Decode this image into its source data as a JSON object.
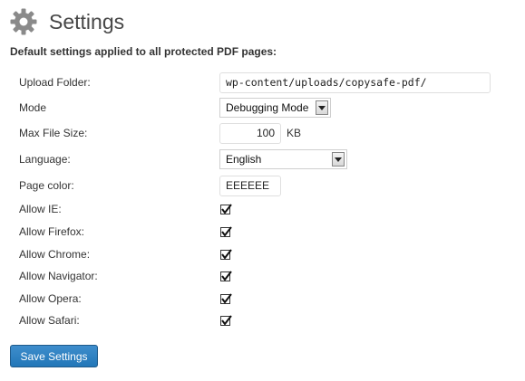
{
  "header": {
    "title": "Settings",
    "icon": "gear-icon"
  },
  "subtitle": "Default settings applied to all protected PDF pages:",
  "fields": {
    "upload_folder": {
      "label": "Upload Folder:",
      "value": "wp-content/uploads/copysafe-pdf/"
    },
    "mode": {
      "label": "Mode",
      "value": "Debugging Mode"
    },
    "max_file_size": {
      "label": "Max File Size:",
      "value": "100",
      "unit": "KB"
    },
    "language": {
      "label": "Language:",
      "value": "English"
    },
    "page_color": {
      "label": "Page color:",
      "value": "EEEEEE"
    }
  },
  "browsers": [
    {
      "label": "Allow IE:",
      "checked": true
    },
    {
      "label": "Allow Firefox:",
      "checked": true
    },
    {
      "label": "Allow Chrome:",
      "checked": true
    },
    {
      "label": "Allow Navigator:",
      "checked": true
    },
    {
      "label": "Allow Opera:",
      "checked": true
    },
    {
      "label": "Allow Safari:",
      "checked": true
    }
  ],
  "save_button": {
    "label": "Save Settings"
  },
  "colors": {
    "button_bg": "#2277b8",
    "title": "#464646"
  }
}
